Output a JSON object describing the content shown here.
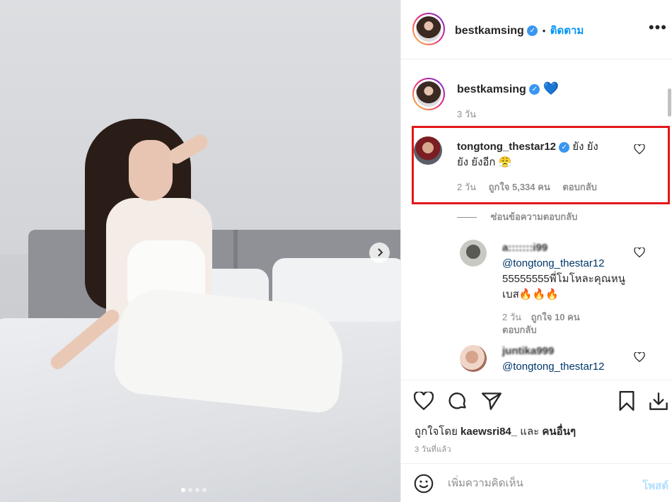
{
  "post": {
    "carousel_next_icon": "chevron-right-icon",
    "carousel_dots": [
      true,
      false,
      false,
      false
    ]
  },
  "header": {
    "username": "bestkamsing",
    "verified_icon": "check-icon",
    "separator": "•",
    "follow_label": "ติดตาม",
    "more_icon": "ellipsis-icon",
    "more_label": "•••"
  },
  "caption": {
    "username": "bestkamsing",
    "emoji": "💙",
    "time": "3 วัน"
  },
  "comments": [
    {
      "username": "tongtong_thestar12",
      "text": "ยัง ยัง ยัง ยังอีก 😤",
      "time": "2 วัน",
      "likes": "ถูกใจ 5,334 คน",
      "reply_label": "ตอบกลับ",
      "highlighted": true
    }
  ],
  "replies_toggle": "ซ่อนข้อความตอบกลับ",
  "replies": [
    {
      "username": "a:::::::i99",
      "mention": "@tongtong_thestar12",
      "text": "55555555พี่โมโหละคุณหนูเบส🔥🔥🔥",
      "time": "2 วัน",
      "likes": "ถูกใจ 10 คน",
      "reply_label": "ตอบกลับ"
    },
    {
      "username": "juntika999",
      "mention": "@tongtong_thestar12"
    }
  ],
  "actions": {
    "like_icon": "heart-icon",
    "comment_icon": "comment-icon",
    "share_icon": "paper-plane-icon",
    "save_icon": "bookmark-icon",
    "download_icon": "download-icon",
    "liked_by_prefix": "ถูกใจโดย",
    "liked_by_user": "kaewsri84_",
    "liked_by_and": "และ",
    "liked_by_others": "คนอื่นๆ",
    "time_ago": "3 วันที่แล้ว"
  },
  "add_comment": {
    "emoji_icon": "smiley-icon",
    "placeholder": "เพิ่มความคิดเห็น",
    "post_label": "โพสต์"
  },
  "colors": {
    "link_blue": "#0095f6",
    "verified_blue": "#3897f0",
    "highlight_red": "#e3161a",
    "post_disabled": "#b2dffc"
  }
}
